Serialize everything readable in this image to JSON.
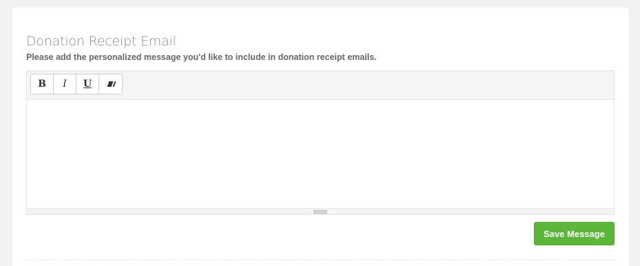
{
  "section": {
    "title": "Donation Receipt Email",
    "subtitle": "Please add the personalized message you'd like to include in donation receipt emails."
  },
  "editor": {
    "toolbar": {
      "bold_label": "B",
      "italic_label": "I",
      "underline_label": "U",
      "clear_format_icon": "eraser-icon"
    },
    "content": ""
  },
  "actions": {
    "save_label": "Save Message"
  },
  "colors": {
    "save_button": "#5cb63a",
    "background": "#f2f2f2"
  }
}
